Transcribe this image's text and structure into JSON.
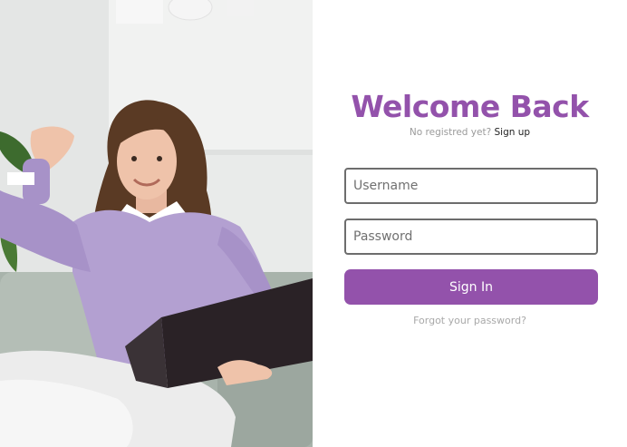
{
  "header": {
    "title": "Welcome Back",
    "subtitle_prefix": "No registred yet?",
    "signup_link": "Sign up"
  },
  "form": {
    "username_placeholder": "Username",
    "password_placeholder": "Password",
    "signin_label": "Sign In",
    "forgot_link": "Forgot your password?"
  },
  "colors": {
    "accent": "#9352ab",
    "field_border": "#6d6d6d",
    "muted_text": "#a9a9a9"
  }
}
